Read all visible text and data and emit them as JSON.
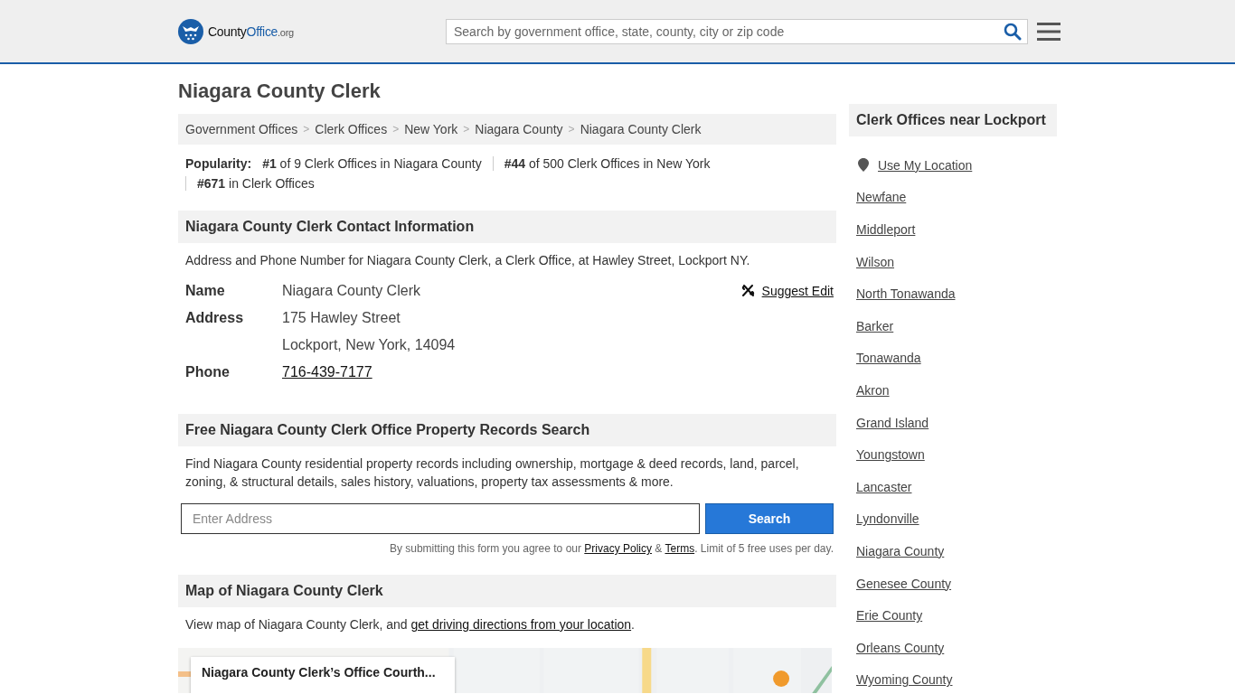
{
  "header": {
    "logo": {
      "county": "County",
      "office": "Office",
      "tld": ".org"
    },
    "search": {
      "placeholder": "Search by government office, state, county, city or zip code"
    }
  },
  "title": "Niagara County Clerk",
  "breadcrumb_separator": ">",
  "breadcrumbs": [
    "Government Offices",
    "Clerk Offices",
    "New York",
    "Niagara County",
    "Niagara County Clerk"
  ],
  "popularity": {
    "label": "Popularity:",
    "ranks": [
      "**#1** of 9 Clerk Offices in Niagara County",
      "**#44** of 500 Clerk Offices in New York",
      "**#671** in Clerk Offices"
    ]
  },
  "contact": {
    "heading": "Niagara County Clerk Contact Information",
    "intro": "Address and Phone Number for Niagara County Clerk, a Clerk Office, at Hawley Street, Lockport NY.",
    "suggest_edit": "Suggest Edit",
    "rows": [
      {
        "label": "Name",
        "values": [
          "Niagara County Clerk"
        ],
        "kind": "text"
      },
      {
        "label": "Address",
        "values": [
          "175 Hawley Street",
          "Lockport, New York, 14094"
        ],
        "kind": "text"
      },
      {
        "label": "Phone",
        "values": [
          "716-439-7177"
        ],
        "kind": "link"
      }
    ]
  },
  "property": {
    "heading": "Free Niagara County Clerk Office Property Records Search",
    "intro": "Find Niagara County residential property records including ownership, mortgage & deed records, land, parcel, zoning, & structural details, sales history, valuations, property tax assessments & more.",
    "placeholder": "Enter Address",
    "button": "Search",
    "disclaimer": [
      "By submitting this form you agree to our",
      "Privacy Policy",
      "&",
      "Terms",
      ". Limit of 5 free uses per day."
    ]
  },
  "map": {
    "heading": "Map of Niagara County Clerk",
    "intro": "View map of Niagara County Clerk, and",
    "link": "get driving directions from your location",
    "period": ".",
    "card_title": "Niagara County Clerk’s Office Courth..."
  },
  "sidebar": {
    "heading": "Clerk Offices near Lockport",
    "use_location": "Use My Location",
    "items": [
      "Newfane",
      "Middleport",
      "Wilson",
      "North Tonawanda",
      "Barker",
      "Tonawanda",
      "Akron",
      "Grand Island",
      "Youngstown",
      "Lancaster",
      "Lyndonville",
      "Niagara County",
      "Genesee County",
      "Erie County",
      "Orleans County",
      "Wyoming County"
    ]
  }
}
